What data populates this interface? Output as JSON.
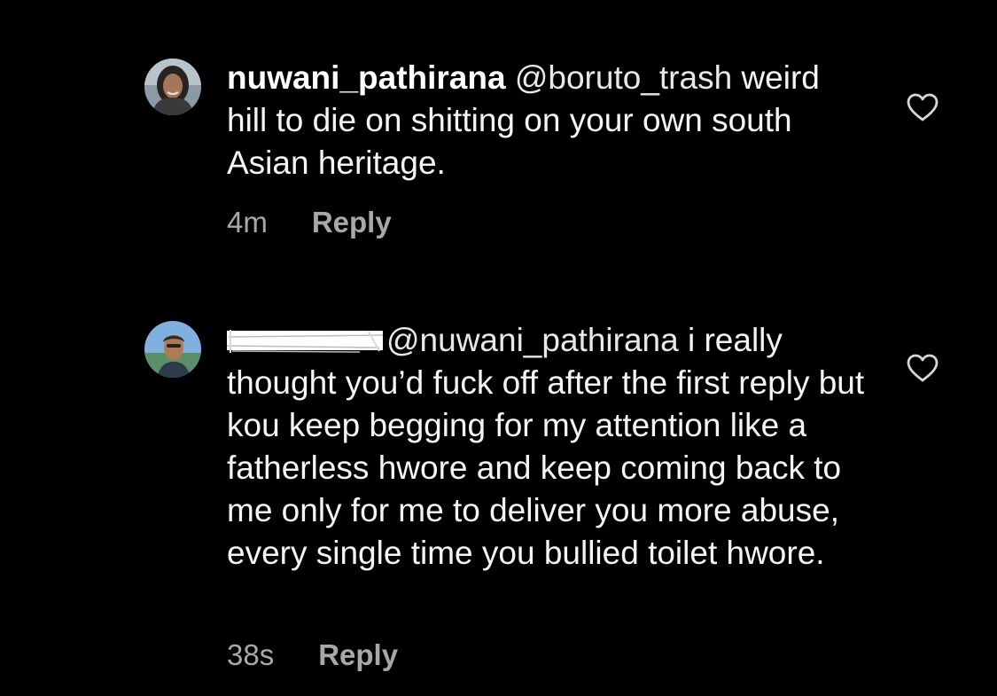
{
  "comments": [
    {
      "username": "nuwani_pathirana",
      "mention": "@boruto_trash",
      "text": "weird hill to die on shitting on your own south Asian heritage.",
      "time": "4m",
      "reply_label": "Reply",
      "avatar_icon": "profile-photo-woman"
    },
    {
      "username": "",
      "username_redacted": true,
      "mention": "@nuwani_pathirana",
      "text": "i really thought you’d fuck off after the first reply but kou keep begging for my attention like a fatherless hwore and keep coming back to me only for me to deliver you more abuse, every single time you bullied toilet hwore.",
      "time": "38s",
      "reply_label": "Reply",
      "avatar_icon": "profile-photo-man"
    }
  ],
  "icons": {
    "like": "heart-outline-icon"
  },
  "colors": {
    "background": "#000000",
    "text": "#ffffff",
    "meta": "#a8a8a8"
  }
}
